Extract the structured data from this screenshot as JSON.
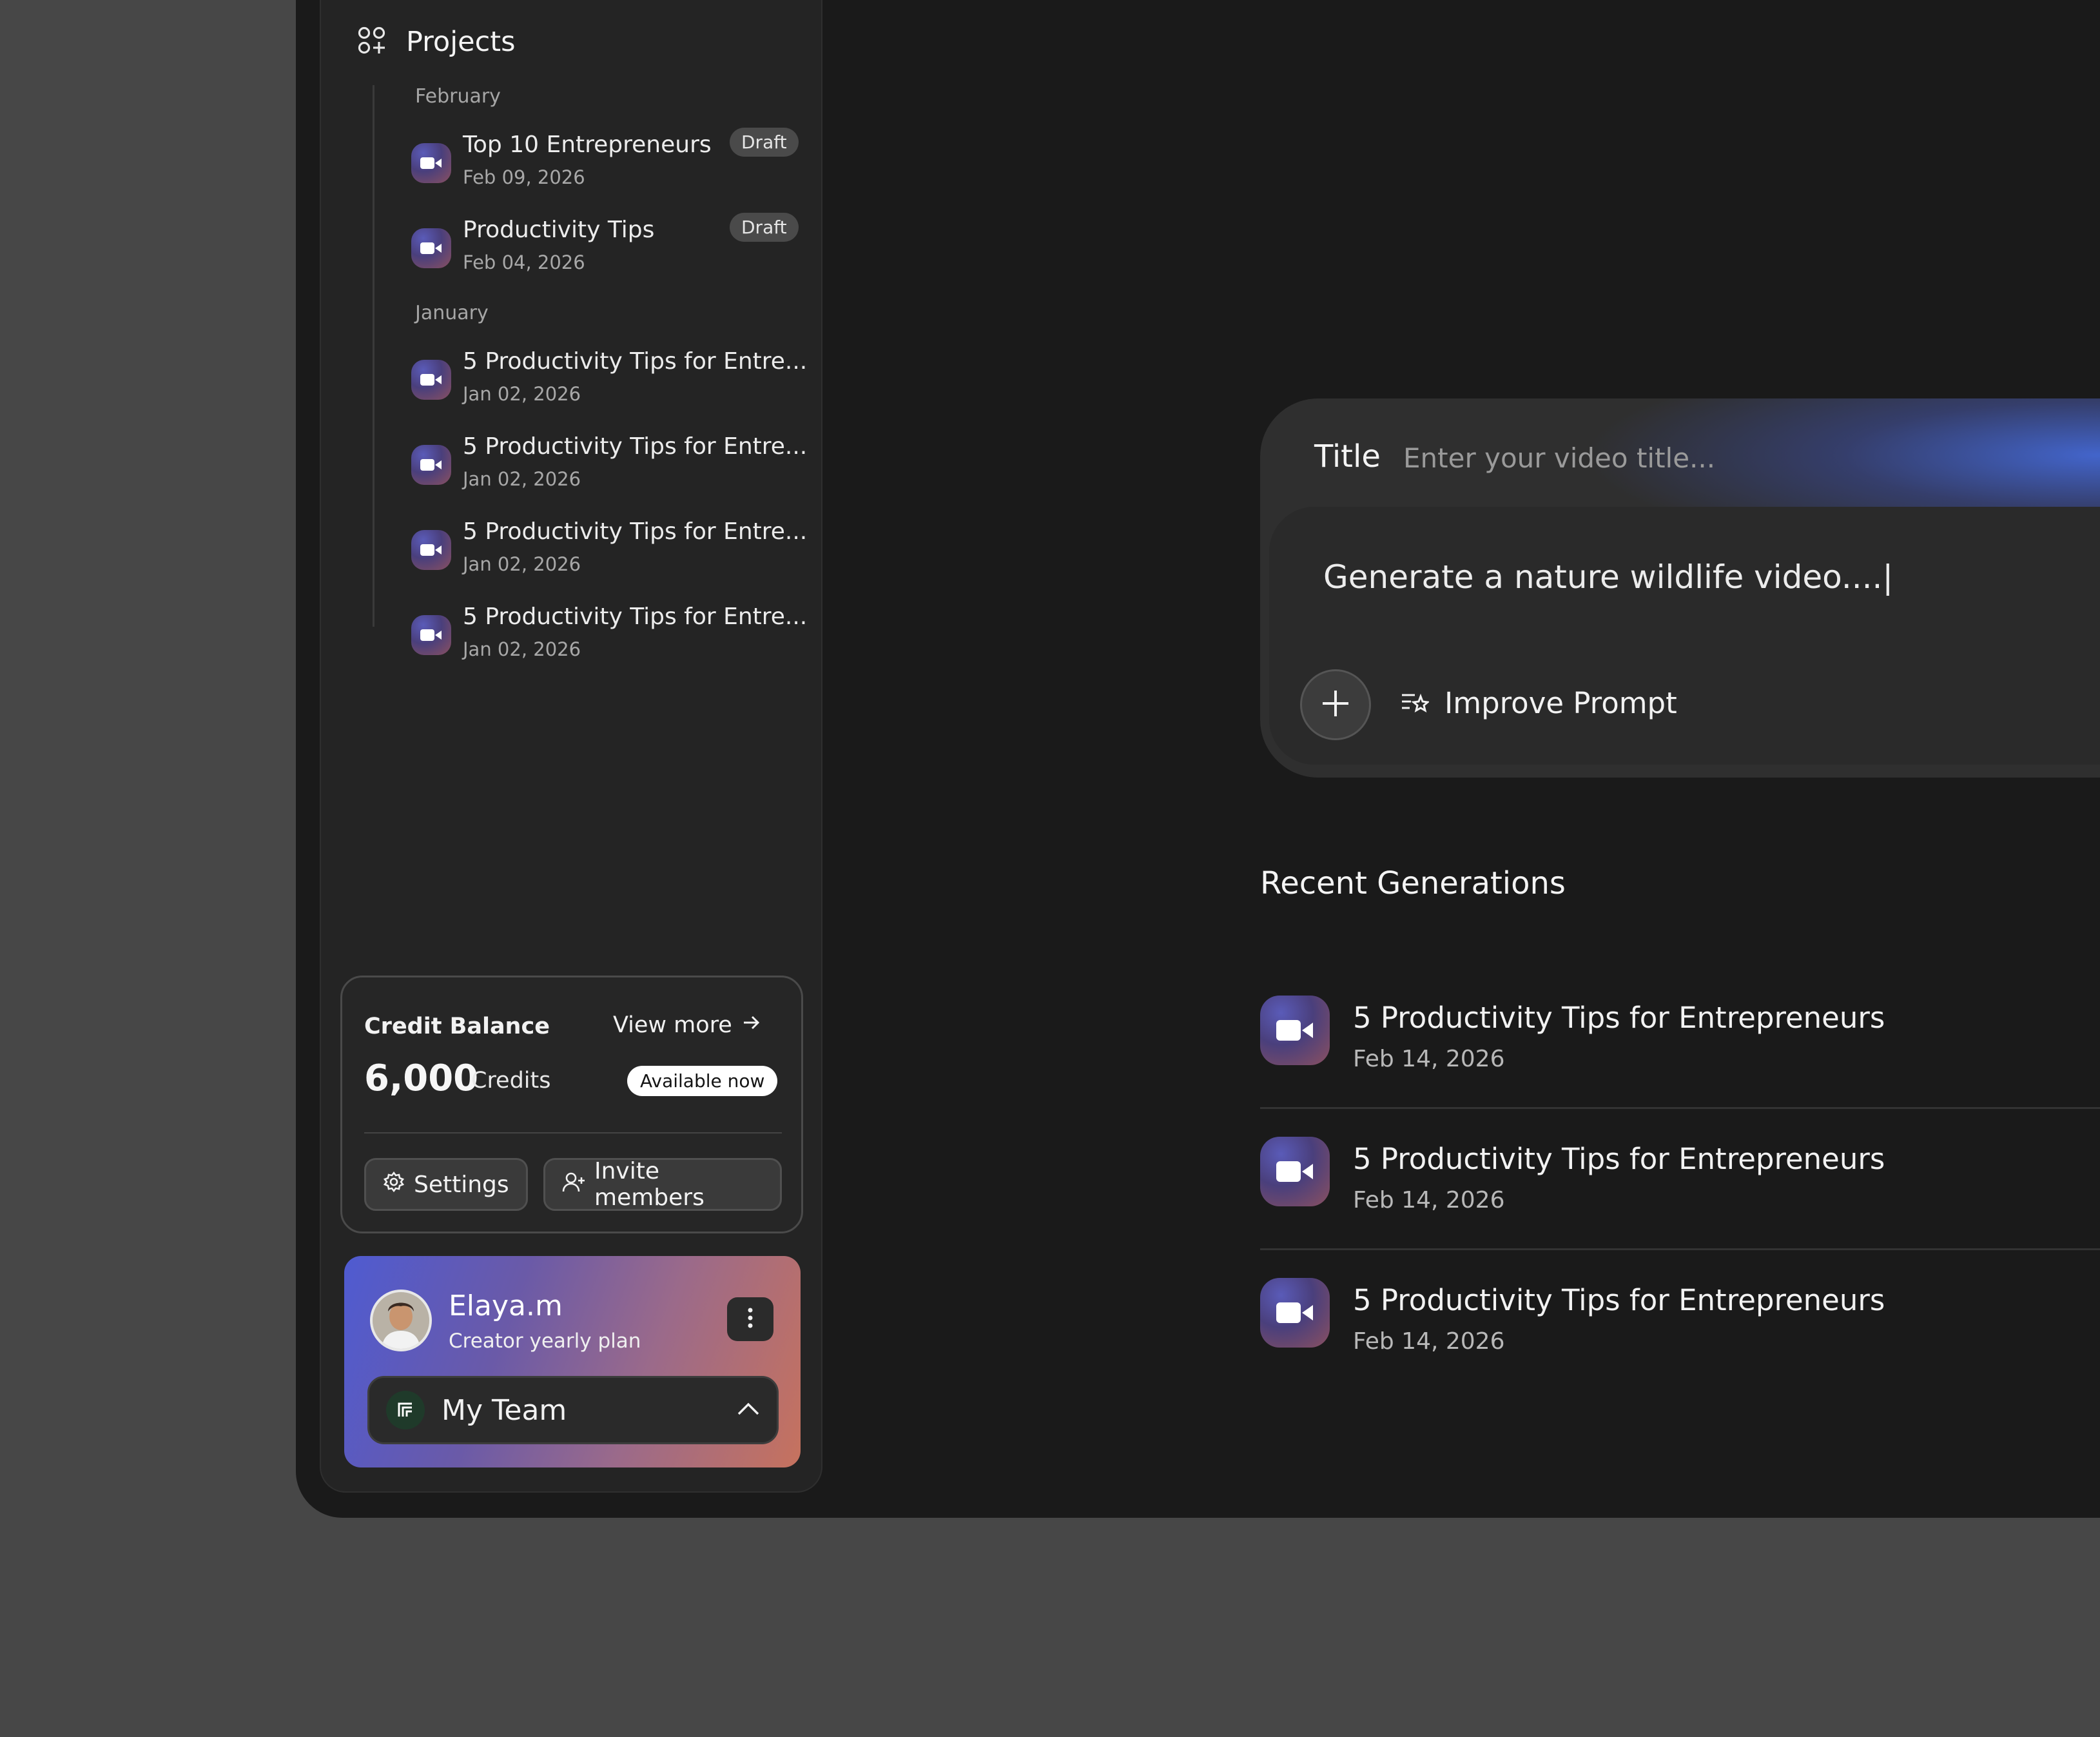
{
  "sidebar": {
    "projects_label": "Projects",
    "groups": [
      {
        "month": "February",
        "items": [
          {
            "name": "Top 10 Entrepreneurs",
            "date": "Feb 09, 2026",
            "badge": "Draft"
          },
          {
            "name": "Productivity Tips",
            "date": "Feb 04, 2026",
            "badge": "Draft"
          }
        ]
      },
      {
        "month": "January",
        "items": [
          {
            "name": "5 Productivity Tips for Entre...",
            "date": "Jan 02, 2026"
          },
          {
            "name": "5 Productivity Tips for Entre...",
            "date": "Jan 02, 2026"
          },
          {
            "name": "5 Productivity Tips for Entre...",
            "date": "Jan 02, 2026"
          },
          {
            "name": "5 Productivity Tips for Entre...",
            "date": "Jan 02, 2026"
          }
        ]
      }
    ],
    "credit": {
      "label": "Credit Balance",
      "view_more": "View more",
      "amount": "6,000",
      "unit": "Credits",
      "status": "Available now",
      "settings_label": "Settings",
      "invite_label": "Invite members"
    },
    "user": {
      "name": "Elaya.m",
      "plan": "Creator yearly plan",
      "team": "My Team"
    }
  },
  "prompt": {
    "title_label": "Title",
    "title_placeholder": "Enter your video title...",
    "prompt_text": "Generate a nature wildlife video....|",
    "improve_label": "Improve Prompt"
  },
  "recent": {
    "heading": "Recent Generations",
    "items": [
      {
        "name": "5 Productivity Tips for Entrepreneurs",
        "date": "Feb 14, 2026"
      },
      {
        "name": "5 Productivity Tips for Entrepreneurs",
        "date": "Feb 14, 2026"
      },
      {
        "name": "5 Productivity Tips for Entrepreneurs",
        "date": "Feb 14, 2026"
      }
    ]
  },
  "colors": {
    "background": "#474747",
    "app_bg": "#1a1a1a",
    "sidebar_bg": "#242424",
    "accent_blue": "#4f5bd1",
    "accent_coral": "#c6725e"
  },
  "icons": {
    "projects": "projects-grid-icon",
    "video": "video-camera-icon",
    "arrow": "arrow-right-icon",
    "settings": "gear-icon",
    "invite": "user-plus-icon",
    "kebab": "more-vertical-icon",
    "chevron": "chevron-up-icon",
    "plus": "plus-icon",
    "improve": "sparkle-list-icon"
  }
}
